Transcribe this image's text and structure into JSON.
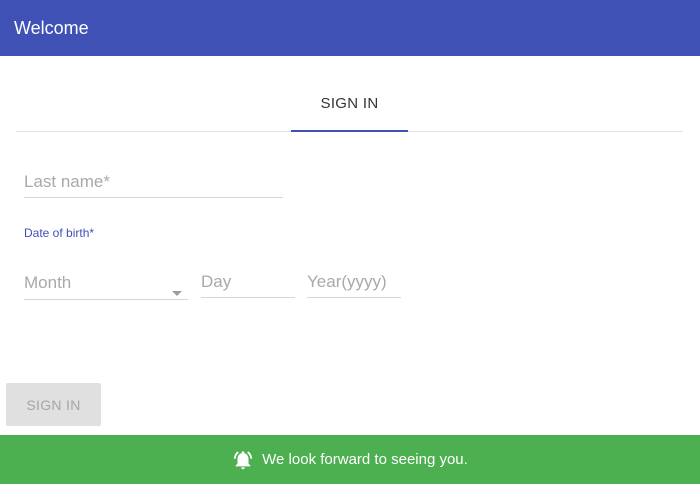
{
  "app_bar": {
    "title": "Welcome",
    "color": "#3f51b5"
  },
  "tabs": [
    {
      "label": "SIGN IN",
      "active": true
    }
  ],
  "form": {
    "last_name": {
      "placeholder": "Last name*",
      "value": ""
    },
    "dob_label": "Date of birth*",
    "month": {
      "placeholder": "Month",
      "value": ""
    },
    "day": {
      "placeholder": "Day",
      "value": ""
    },
    "year": {
      "placeholder": "Year(yyyy)",
      "value": ""
    },
    "submit_label": "SIGN IN"
  },
  "snackbar": {
    "icon": "bell-icon",
    "message": "We look forward to seeing you.",
    "color": "#4caf50"
  }
}
